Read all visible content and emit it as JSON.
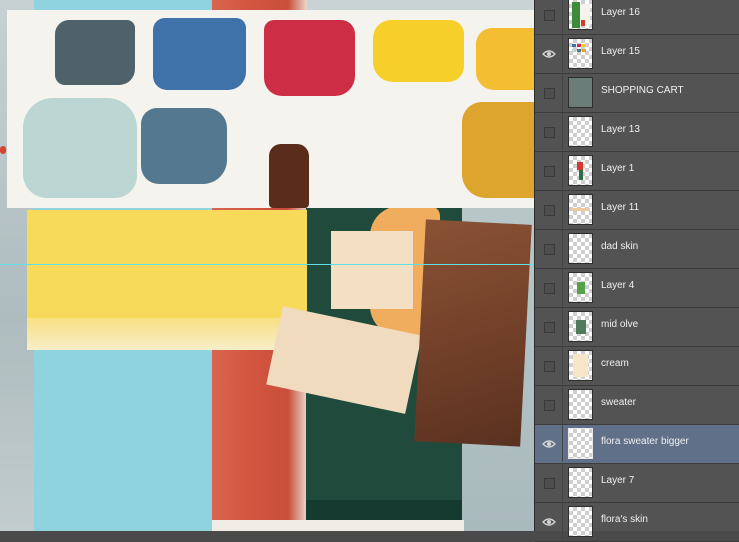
{
  "layers_panel": {
    "layers": [
      {
        "name": "Layer 16",
        "visible": false,
        "thumb": "green-figure",
        "selected": false
      },
      {
        "name": "Layer 15",
        "visible": true,
        "thumb": "color-swatches",
        "selected": false
      },
      {
        "name": "SHOPPING CART",
        "visible": false,
        "thumb": "gray-folder",
        "selected": false
      },
      {
        "name": "Layer 13",
        "visible": false,
        "thumb": "transparent",
        "selected": false
      },
      {
        "name": "Layer 1",
        "visible": false,
        "thumb": "small-figure",
        "selected": false
      },
      {
        "name": "Layer 11",
        "visible": false,
        "thumb": "peach-line",
        "selected": false
      },
      {
        "name": "dad skin",
        "visible": false,
        "thumb": "transparent",
        "selected": false
      },
      {
        "name": "Layer 4",
        "visible": false,
        "thumb": "green-block",
        "selected": false
      },
      {
        "name": "mid olve",
        "visible": false,
        "thumb": "olive-block",
        "selected": false
      },
      {
        "name": "cream",
        "visible": false,
        "thumb": "cream-block",
        "selected": false
      },
      {
        "name": "sweater",
        "visible": false,
        "thumb": "transparent",
        "selected": false
      },
      {
        "name": "flora sweater bigger",
        "visible": true,
        "thumb": "transparent",
        "selected": true
      },
      {
        "name": "Layer 7",
        "visible": false,
        "thumb": "transparent",
        "selected": false
      },
      {
        "name": "flora's skin",
        "visible": true,
        "thumb": "transparent",
        "selected": false
      }
    ]
  },
  "colors": {
    "panel_bg": "#535353",
    "selected_row": "#5f7088",
    "guide_line": "#5fe0e8"
  }
}
